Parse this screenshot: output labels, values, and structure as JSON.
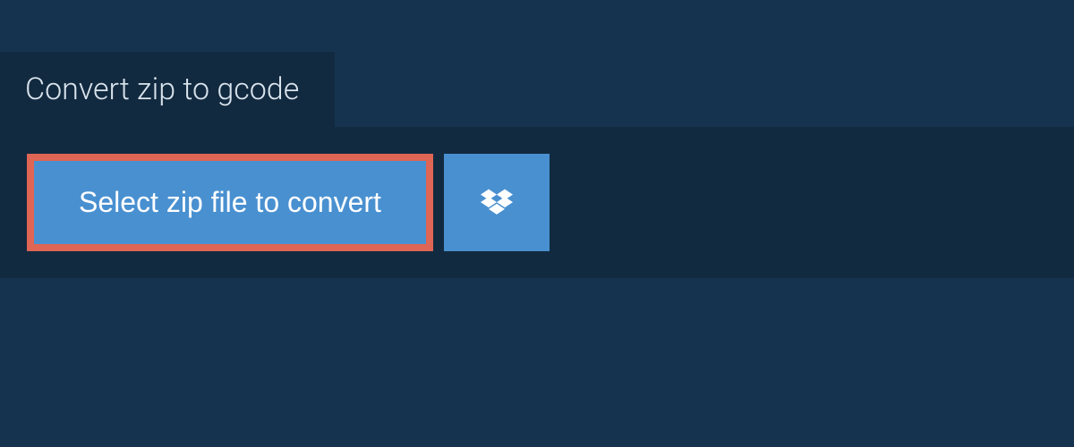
{
  "tab": {
    "title": "Convert zip to gcode"
  },
  "actions": {
    "select_file_label": "Select zip file to convert"
  },
  "colors": {
    "background": "#15334e",
    "panel": "#122a40",
    "button": "#4990d0",
    "highlight_border": "#df6554",
    "text_light": "#d9e3ec"
  }
}
